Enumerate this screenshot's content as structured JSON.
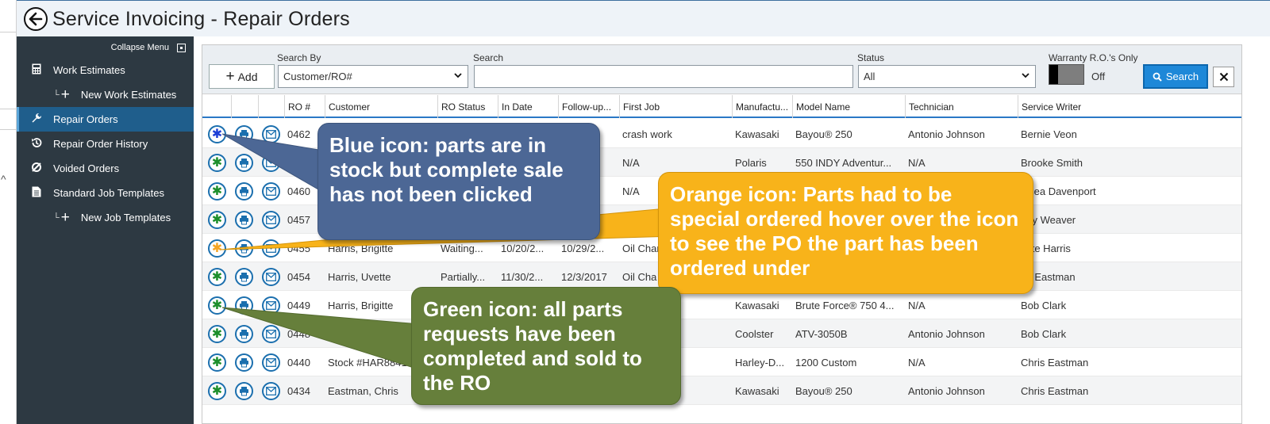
{
  "header": {
    "title": "Service Invoicing - Repair Orders"
  },
  "sidebar": {
    "collapse_label": "Collapse Menu",
    "items": [
      {
        "label": "Work Estimates",
        "icon": "calculator-icon",
        "sub": false,
        "active": false
      },
      {
        "label": "New Work Estimates",
        "icon": "plus-icon",
        "sub": true,
        "active": false
      },
      {
        "label": "Repair Orders",
        "icon": "wrench-icon",
        "sub": false,
        "active": true
      },
      {
        "label": "Repair Order History",
        "icon": "history-icon",
        "sub": false,
        "active": false
      },
      {
        "label": "Voided Orders",
        "icon": "void-icon",
        "sub": false,
        "active": false
      },
      {
        "label": "Standard Job Templates",
        "icon": "document-icon",
        "sub": false,
        "active": false
      },
      {
        "label": "New Job Templates",
        "icon": "plus-icon",
        "sub": true,
        "active": false
      }
    ]
  },
  "toolbar": {
    "add_label": "Add",
    "search_by_label": "Search By",
    "search_by_value": "Customer/RO#",
    "search_label": "Search",
    "search_value": "",
    "status_label": "Status",
    "status_value": "All",
    "warranty_label": "Warranty R.O.'s Only",
    "warranty_state": "Off",
    "search_button": "Search"
  },
  "grid": {
    "columns": [
      "RO #",
      "Customer",
      "RO Status",
      "In Date",
      "Follow-up...",
      "First Job",
      "Manufactu...",
      "Model Name",
      "Technician",
      "Service Writer"
    ],
    "rows": [
      {
        "status_icon": "blue",
        "ro": "0462",
        "customer": "",
        "status": "",
        "in_date": "",
        "followup": "",
        "first_job": "crash work",
        "manufacturer": "Kawasaki",
        "model": "Bayou® 250",
        "technician": "Antonio Johnson",
        "writer": "Bernie Veon"
      },
      {
        "status_icon": "green",
        "ro": "045",
        "customer": "",
        "status": "",
        "in_date": "",
        "followup": "",
        "first_job": "N/A",
        "manufacturer": "Polaris",
        "model": "550 INDY Adventur...",
        "technician": "N/A",
        "writer": "Brooke Smith"
      },
      {
        "status_icon": "green",
        "ro": "0460",
        "customer": "",
        "status": "",
        "in_date": "",
        "followup": "",
        "first_job": "N/A",
        "manufacturer": "",
        "model": "",
        "technician": "",
        "writer": "elsea Davenport"
      },
      {
        "status_icon": "green",
        "ro": "0457",
        "customer": "",
        "status": "",
        "in_date": "",
        "followup": "",
        "first_job": "Oil Ch",
        "manufacturer": "",
        "model": "",
        "technician": "",
        "writer": "bby Weaver"
      },
      {
        "status_icon": "orange",
        "ro": "0455",
        "customer": "Harris, Brigitte",
        "status": "Waiting...",
        "in_date": "10/20/2...",
        "followup": "10/29/2...",
        "first_job": "Oil Chan",
        "manufacturer": "",
        "model": "",
        "technician": "",
        "writer": "gitte Harris"
      },
      {
        "status_icon": "green",
        "ro": "0454",
        "customer": "Harris, Uvette",
        "status": "Partially...",
        "in_date": "11/30/2...",
        "followup": "12/3/2017",
        "first_job": "Oil Cha",
        "manufacturer": "",
        "model": "",
        "technician": "",
        "writer": "ris Eastman"
      },
      {
        "status_icon": "green",
        "ro": "0449",
        "customer": "Harris, Brigitte",
        "status": "",
        "in_date": "",
        "followup": "",
        "first_job": "",
        "manufacturer": "Kawasaki",
        "model": "Brute Force® 750 4...",
        "technician": "N/A",
        "writer": "Bob Clark"
      },
      {
        "status_icon": "green",
        "ro": "0448",
        "customer": "",
        "status": "",
        "in_date": "",
        "followup": "",
        "first_job": "",
        "manufacturer": "Coolster",
        "model": "ATV-3050B",
        "technician": "Antonio Johnson",
        "writer": "Bob Clark"
      },
      {
        "status_icon": "green",
        "ro": "0440",
        "customer": "Stock #HAR88414",
        "status": "",
        "in_date": "",
        "followup": "",
        "first_job": "",
        "manufacturer": "Harley-D...",
        "model": "1200 Custom",
        "technician": "N/A",
        "writer": "Chris Eastman"
      },
      {
        "status_icon": "green",
        "ro": "0434",
        "customer": "Eastman, Chris",
        "status": "",
        "in_date": "",
        "followup": "",
        "first_job": "",
        "manufacturer": "Kawasaki",
        "model": "Bayou® 250",
        "technician": "Antonio Johnson",
        "writer": "Chris Eastman"
      }
    ]
  },
  "callouts": {
    "blue": "Blue icon: parts are in stock but complete sale has not been clicked",
    "orange": "Orange icon: Parts had to be special ordered hover over the icon to see the PO the part has been ordered under",
    "green": "Green icon: all parts requests have been completed and sold to the RO"
  },
  "colors": {
    "sidebar_bg": "#2d3942",
    "active_item": "#1f5e8c",
    "search_button": "#1e88d8",
    "callout_blue": "#4c6795",
    "callout_orange": "#f8b31a",
    "callout_green": "#667f3b"
  }
}
